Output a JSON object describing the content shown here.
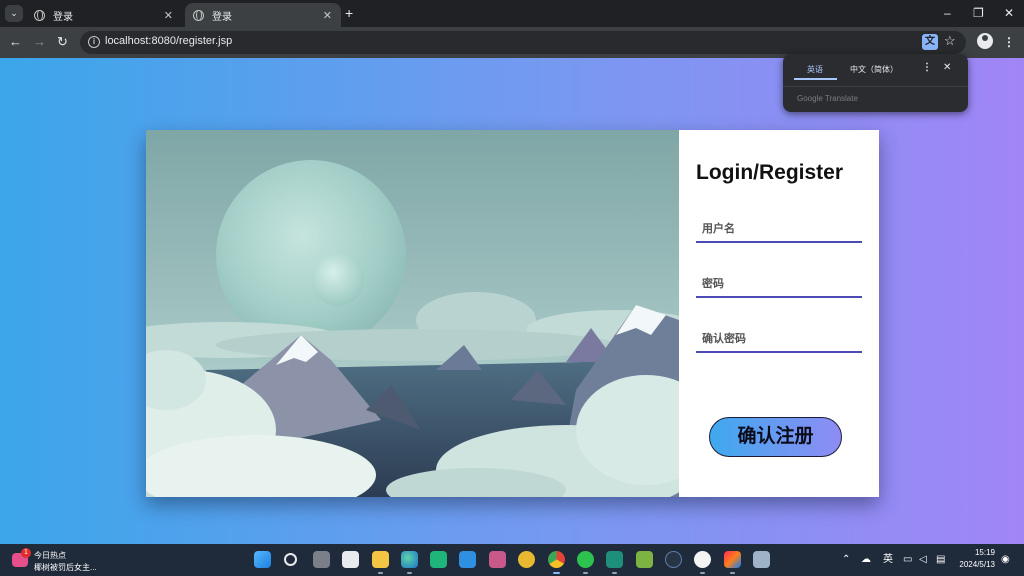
{
  "browser": {
    "tabs": [
      {
        "title": "登录",
        "active": false
      },
      {
        "title": "登录",
        "active": true
      }
    ],
    "address": "localhost:8080/register.jsp",
    "icons": {
      "tab_search": "chevron-down-icon",
      "new_tab": "plus-icon",
      "back": "arrow-left-icon",
      "forward": "arrow-right-icon",
      "reload": "reload-icon",
      "site_info": "info-icon",
      "translate": "translate-icon",
      "bookmark": "star-icon",
      "profile": "profile-icon",
      "menu": "kebab-menu-icon",
      "minimize": "minimize-icon",
      "restore": "restore-icon",
      "close": "close-icon"
    }
  },
  "translate_popup": {
    "tab_source": "英语",
    "tab_target": "中文（简体）",
    "brand": "Google Translate"
  },
  "page": {
    "title": "Login/Register",
    "fields": {
      "username_placeholder": "用户名",
      "password_placeholder": "密码",
      "confirm_placeholder": "确认密码"
    },
    "submit_label": "确认注册",
    "colors": {
      "bg_left": "#3ba6ea",
      "bg_right": "#a185f7",
      "underline": "#4c4bb5"
    }
  },
  "taskbar": {
    "news_count": "1",
    "news_title": "今日热点",
    "news_sub": "椰树被罚后女主...",
    "apps": [
      "windows-start",
      "search",
      "task-view",
      "store",
      "file-explorer",
      "edge",
      "app-green",
      "vscode",
      "app-pink",
      "app-yellow",
      "chrome",
      "wechat",
      "app-teal",
      "app-green2",
      "app-dark",
      "qq",
      "intellij",
      "app-remote"
    ],
    "tray": {
      "ime": "英",
      "time": "15:19",
      "date": "2024/5/13"
    }
  }
}
